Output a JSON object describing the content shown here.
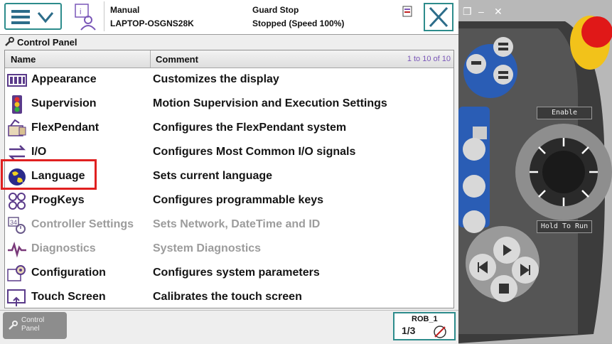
{
  "header": {
    "mode": "Manual",
    "controller": "LAPTOP-OSGNS28K",
    "state": "Guard Stop",
    "speed": "Stopped (Speed 100%)"
  },
  "breadcrumb": {
    "label": "Control Panel"
  },
  "table": {
    "columns": [
      "Name",
      "Comment"
    ],
    "count": "1 to 10 of 10",
    "rows": [
      {
        "name": "Appearance",
        "comment": "Customizes the display",
        "icon": "appearance-icon"
      },
      {
        "name": "Supervision",
        "comment": "Motion Supervision and Execution Settings",
        "icon": "supervision-icon"
      },
      {
        "name": "FlexPendant",
        "comment": "Configures the FlexPendant system",
        "icon": "flexpendant-icon"
      },
      {
        "name": "I/O",
        "comment": "Configures Most Common I/O signals",
        "icon": "io-icon"
      },
      {
        "name": "Language",
        "comment": "Sets current language",
        "icon": "globe-icon"
      },
      {
        "name": "ProgKeys",
        "comment": "Configures programmable keys",
        "icon": "progkeys-icon"
      },
      {
        "name": "Controller Settings",
        "comment": "Sets Network, DateTime and ID",
        "icon": "controller-settings-icon",
        "disabled": true
      },
      {
        "name": "Diagnostics",
        "comment": "System Diagnostics",
        "icon": "diagnostics-icon",
        "disabled": true
      },
      {
        "name": "Configuration",
        "comment": "Configures system parameters",
        "icon": "configuration-icon"
      },
      {
        "name": "Touch Screen",
        "comment": "Calibrates the touch screen",
        "icon": "touchscreen-icon"
      }
    ]
  },
  "taskbar": {
    "control_panel_line1": "Control",
    "control_panel_line2": "Panel",
    "robot": "ROB_1",
    "fraction": "1/3"
  },
  "pendant": {
    "enable_label": "Enable",
    "hold_label": "Hold To Run"
  },
  "colors": {
    "accent": "#2d8c8c",
    "highlight": "#e02020",
    "pendant_blue": "#2a5db5"
  }
}
